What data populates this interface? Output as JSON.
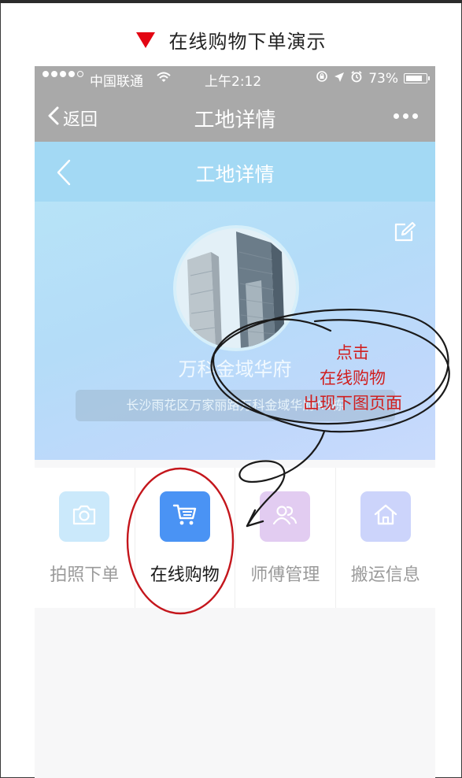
{
  "caption": {
    "text": "在线购物下单演示"
  },
  "status_bar": {
    "carrier": "中国联通",
    "time": "上午2:12",
    "battery": "73%"
  },
  "nav": {
    "back_label": "返回",
    "title": "工地详情"
  },
  "sub_nav": {
    "title": "工地详情"
  },
  "site": {
    "name": "万科金域华府",
    "address": "长沙雨花区万家丽路万科金域华府A3栋"
  },
  "actions": [
    {
      "label": "拍照下单",
      "icon": "camera-icon",
      "color": "#cbe9fb",
      "text_color": "#9a9a9a"
    },
    {
      "label": "在线购物",
      "icon": "cart-icon",
      "color": "#4a93f4",
      "text_color": "#1a1a1a"
    },
    {
      "label": "师傅管理",
      "icon": "users-icon",
      "color": "#e2ccf1",
      "text_color": "#9a9a9a"
    },
    {
      "label": "搬运信息",
      "icon": "home-icon",
      "color": "#ccd4fb",
      "text_color": "#9a9a9a"
    }
  ],
  "annotation": {
    "line1": "点击",
    "line2": "在线购物",
    "line3": "出现下图页面",
    "color": "#d01f1f"
  }
}
